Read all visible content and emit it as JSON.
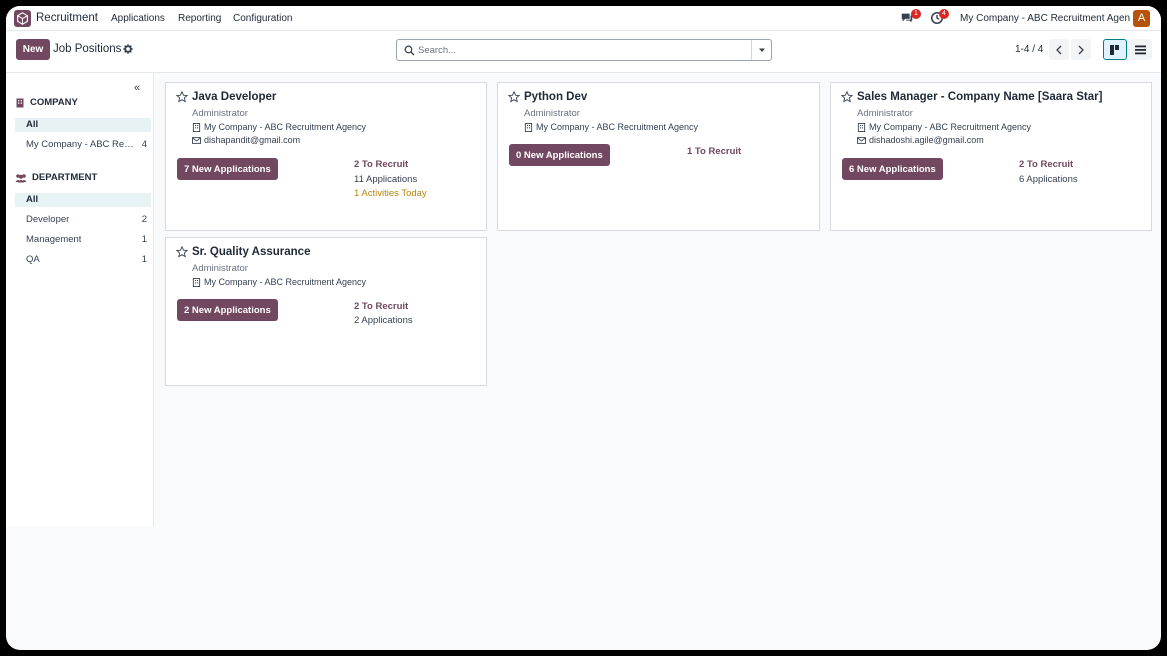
{
  "nav": {
    "app_name": "Recruitment",
    "menu": [
      "Applications",
      "Reporting",
      "Configuration"
    ],
    "messages_count": "1",
    "activities_count": "4",
    "company": "My Company - ABC Recruitment Agency",
    "avatar_initial": "A"
  },
  "control": {
    "new_label": "New",
    "title": "Job Positions",
    "search_placeholder": "Search...",
    "pager": "1-4 / 4"
  },
  "sidebar": {
    "company_head": "COMPANY",
    "company_facets": [
      {
        "label": "All",
        "count": ""
      },
      {
        "label": "My Company - ABC Recruitment Agency",
        "count": "4"
      }
    ],
    "department_head": "DEPARTMENT",
    "department_facets": [
      {
        "label": "All",
        "count": ""
      },
      {
        "label": "Developer",
        "count": "2"
      },
      {
        "label": "Management",
        "count": "1"
      },
      {
        "label": "QA",
        "count": "1"
      }
    ]
  },
  "cards": [
    {
      "title": "Java Developer",
      "recruiter": "Administrator",
      "company": "My Company - ABC Recruitment Agency",
      "email": "dishapandit@gmail.com",
      "button": "7 New Applications",
      "to_recruit": "2 To Recruit",
      "applications": "11 Applications",
      "activities": "1 Activities Today"
    },
    {
      "title": "Python Dev",
      "recruiter": "Administrator",
      "company": "My Company - ABC Recruitment Agency",
      "button": "0 New Applications",
      "to_recruit": "1 To Recruit"
    },
    {
      "title": "Sales Manager - Company Name [Saara Star]",
      "recruiter": "Administrator",
      "company": "My Company - ABC Recruitment Agency",
      "email": "dishadoshi.agile@gmail.com",
      "button": "6 New Applications",
      "to_recruit": "2 To Recruit",
      "applications": "6 Applications"
    },
    {
      "title": "Sr. Quality Assurance",
      "recruiter": "Administrator",
      "company": "My Company - ABC Recruitment Agency",
      "button": "2 New Applications",
      "to_recruit": "2 To Recruit",
      "applications": "2 Applications"
    }
  ],
  "colors": {
    "brand": "#71485f",
    "accent": "#017e84",
    "activity": "#b8860b",
    "badge": "#dc2626"
  }
}
